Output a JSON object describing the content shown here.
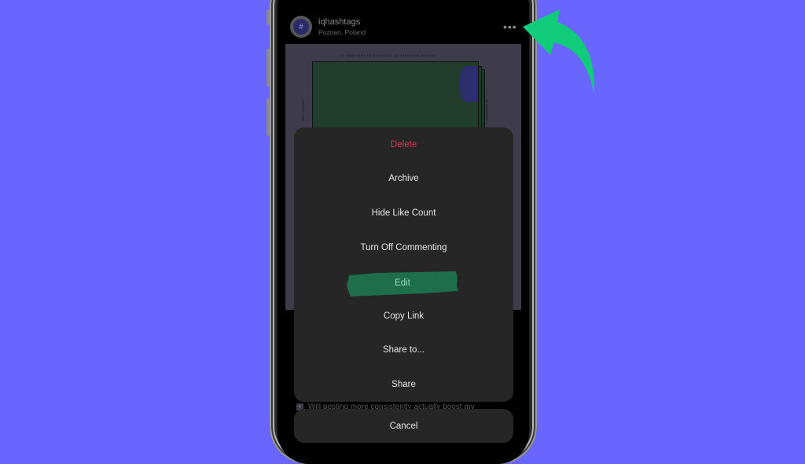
{
  "post": {
    "username": "iqhashtags",
    "location": "Poznan, Poland",
    "avatar_glyph": "#",
    "more_icon": "more-horizontal-icon",
    "image_caption_top": "IQ HASHTAGS IQ HASHTAGS IQ HASHTAGS SCHOOL",
    "image_side_left": "TAGS SCHOOL",
    "image_side_right": "IQ HASHTAGS",
    "caption_text": "Will posting more consistently actually boost my"
  },
  "action_sheet": {
    "items": [
      {
        "label": "Delete",
        "style": "destructive"
      },
      {
        "label": "Archive",
        "style": "default"
      },
      {
        "label": "Hide Like Count",
        "style": "default"
      },
      {
        "label": "Turn Off Commenting",
        "style": "default"
      },
      {
        "label": "Edit",
        "style": "highlighted"
      },
      {
        "label": "Copy Link",
        "style": "default"
      },
      {
        "label": "Share to...",
        "style": "default"
      },
      {
        "label": "Share",
        "style": "default"
      }
    ],
    "cancel_label": "Cancel"
  },
  "colors": {
    "background": "#6966ff",
    "destructive": "#e0364f",
    "highlight": "#1e6e4c",
    "arrow": "#10cc7a"
  }
}
